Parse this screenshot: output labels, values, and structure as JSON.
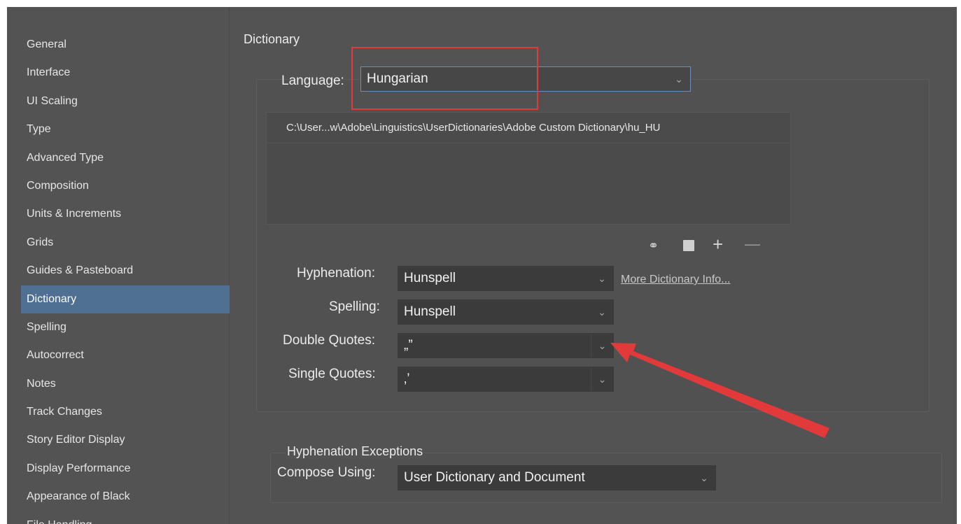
{
  "sidebar": {
    "items": [
      "General",
      "Interface",
      "UI Scaling",
      "Type",
      "Advanced Type",
      "Composition",
      "Units & Increments",
      "Grids",
      "Guides & Pasteboard",
      "Dictionary",
      "Spelling",
      "Autocorrect",
      "Notes",
      "Track Changes",
      "Story Editor Display",
      "Display Performance",
      "Appearance of Black",
      "File Handling"
    ],
    "selected_index": 9
  },
  "main": {
    "section_title": "Dictionary",
    "language_label": "Language:",
    "language_value": "Hungarian",
    "dictionary_path": "C:\\User...w\\Adobe\\Linguistics\\UserDictionaries\\Adobe Custom Dictionary\\hu_HU",
    "hyphenation_label": "Hyphenation:",
    "hyphenation_value": "Hunspell",
    "more_info_link": "More Dictionary Info...",
    "spelling_label": "Spelling:",
    "spelling_value": "Hunspell",
    "double_quotes_label": "Double Quotes:",
    "double_quotes_value": "„”",
    "single_quotes_label": "Single Quotes:",
    "single_quotes_value": "‚’",
    "hyph_exceptions_title": "Hyphenation Exceptions",
    "compose_using_label": "Compose Using:",
    "compose_using_value": "User Dictionary and Document"
  },
  "icons": {
    "link": "link-icon",
    "new": "new-dictionary-icon",
    "add": "add-icon",
    "remove": "remove-icon",
    "caret": "chevron-down-icon"
  },
  "colors": {
    "panel_bg": "#535353",
    "selected_bg": "#4f6f93",
    "field_bg": "#3b3b3b",
    "annotation_red": "#e23a3a"
  }
}
